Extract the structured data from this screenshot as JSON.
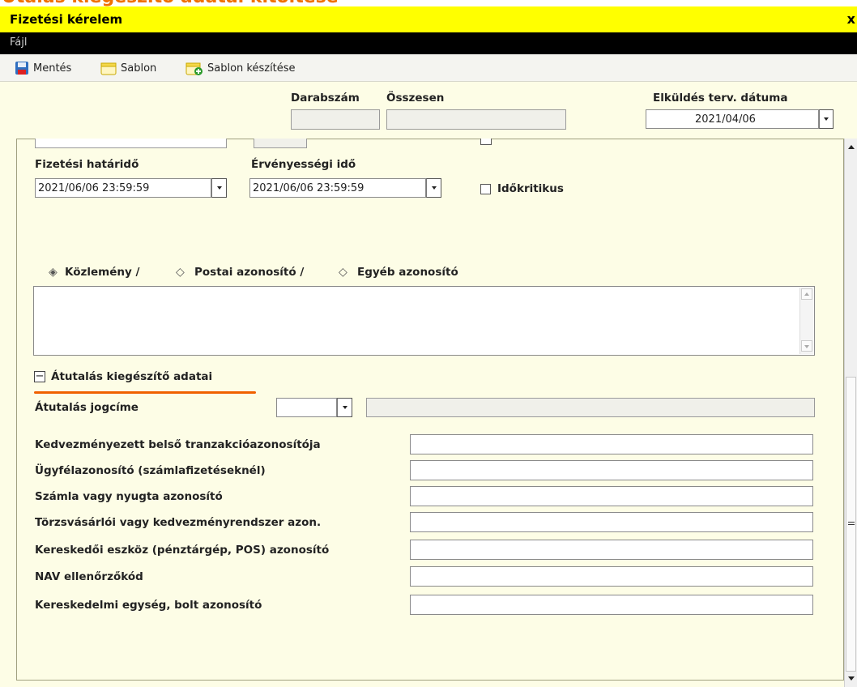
{
  "page_title": "Utalás kiegészítő adatai kitöltése",
  "window": {
    "title": "Fizetési kérelem",
    "close_glyph": "x"
  },
  "menu": {
    "file": "Fájl"
  },
  "toolbar": {
    "save": "Mentés",
    "template": "Sablon",
    "make_template": "Sablon készítése"
  },
  "header": {
    "count_label": "Darabszám",
    "total_label": "Összesen",
    "count_value": "",
    "total_value": "",
    "send_date_label": "Elküldés terv. dátuma",
    "send_date_value": "2021/04/06"
  },
  "form": {
    "deadline_label": "Fizetési határidő",
    "deadline_value": "2021/06/06 23:59:59",
    "validity_label": "Érvényességi idő",
    "validity_value": "2021/06/06 23:59:59",
    "time_critical_label": "Időkritikus",
    "time_critical_checked": false,
    "reference_options": [
      "Közlemény /",
      "Postai azonosító /",
      "Egyéb azonosító"
    ],
    "reference_selected": "Közlemény /",
    "reference_text": ""
  },
  "transfer": {
    "section_toggle_glyph": "−",
    "section_title": "Átutalás kiegészítő adatai",
    "legal_basis_label": "Átutalás jogcíme",
    "legal_basis_value": "",
    "legal_basis_text": "",
    "fields": [
      {
        "label": "Kedvezményezett belső tranzakcióazonosítója",
        "value": ""
      },
      {
        "label": "Ügyfélazonosító (számlafizetéseknél)",
        "value": ""
      },
      {
        "label": "Számla vagy nyugta azonosító",
        "value": ""
      },
      {
        "label": "Törzsvásárlói vagy kedvezményrendszer azon.",
        "value": ""
      },
      {
        "label": "Kereskedői eszköz (pénztárgép, POS) azonosító",
        "value": ""
      },
      {
        "label": "NAV ellenőrzőkód",
        "value": ""
      },
      {
        "label": "Kereskedelmi egység, bolt azonosító",
        "value": ""
      }
    ]
  },
  "colors": {
    "accent_orange": "#f07000",
    "titlebar_yellow": "#ffff00",
    "panel_bg": "#fdfde6"
  }
}
